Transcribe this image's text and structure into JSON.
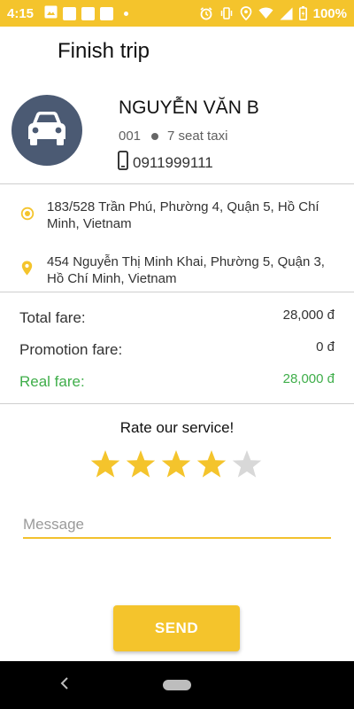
{
  "status_bar": {
    "time": "4:15",
    "battery": "100%",
    "left_icons": [
      "image-icon",
      "square-icon",
      "square-icon",
      "square-icon",
      "dot-icon"
    ],
    "right_icons": [
      "alarm-icon",
      "vibrate-icon",
      "location-icon",
      "wifi-icon",
      "signal-icon",
      "battery-icon"
    ]
  },
  "header": {
    "title": "Finish trip"
  },
  "driver": {
    "name": "NGUYỄN VĂN B",
    "vehicle_id": "001",
    "vehicle_type": "7 seat taxi",
    "phone": "0911999111",
    "avatar_icon": "car-icon"
  },
  "route": {
    "pickup": "183/528 Trần Phú, Phường 4, Quận 5, Hồ Chí Minh, Vietnam",
    "dropoff": "454 Nguyễn Thị Minh Khai, Phường 5, Quận 3, Hồ Chí Minh, Vietnam"
  },
  "fare": {
    "total_label": "Total fare:",
    "total_value": "28,000 đ",
    "promotion_label": "Promotion fare:",
    "promotion_value": "0 đ",
    "real_label": "Real fare:",
    "real_value": "28,000 đ"
  },
  "rating": {
    "title": "Rate our service!",
    "value": 4,
    "max": 5
  },
  "message": {
    "placeholder": "Message",
    "value": ""
  },
  "send_label": "SEND",
  "colors": {
    "accent": "#f4c42c",
    "green": "#3fae4a",
    "avatar_bg": "#4b5a73",
    "star_empty": "#d8d8d8"
  }
}
